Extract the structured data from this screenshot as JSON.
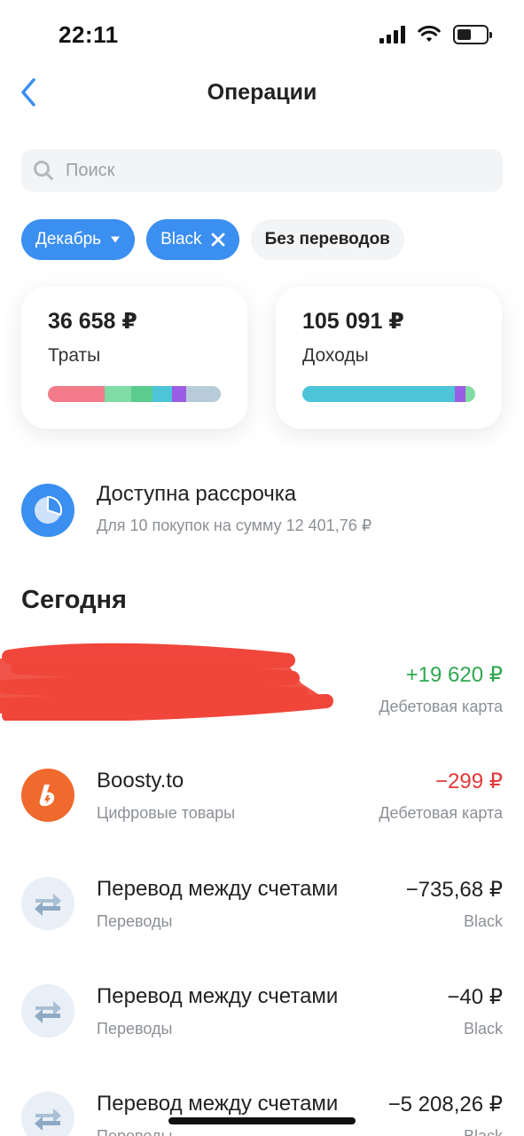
{
  "status": {
    "time": "22:11"
  },
  "header": {
    "title": "Операции"
  },
  "search": {
    "placeholder": "Поиск"
  },
  "filters": {
    "month": "Декабрь",
    "card": "Black",
    "transfers": "Без переводов"
  },
  "summary": {
    "expenses": {
      "amount": "36 658 ₽",
      "label": "Траты"
    },
    "income": {
      "amount": "105 091 ₽",
      "label": "Доходы"
    }
  },
  "colors": {
    "accent": "#3b8ff0",
    "income_green": "#2fa84f",
    "expense_red": "#e33838",
    "boosty_orange": "#ef6a2c"
  },
  "installment": {
    "title": "Доступна рассрочка",
    "subtitle": "Для 10 покупок на сумму 12 401,76 ₽"
  },
  "section": {
    "today": "Сегодня"
  },
  "operations": [
    {
      "title": "",
      "category": "",
      "amount": "+19 620 ₽",
      "account": "Дебетовая карта",
      "icon": "redacted"
    },
    {
      "title": "Boosty.to",
      "category": "Цифровые товары",
      "amount": "−299 ₽",
      "account": "Дебетовая карта",
      "icon": "boosty-icon"
    },
    {
      "title": "Перевод между счетами",
      "category": "Переводы",
      "amount": "−735,68 ₽",
      "account": "Black",
      "icon": "transfer-icon"
    },
    {
      "title": "Перевод между счетами",
      "category": "Переводы",
      "amount": "−40 ₽",
      "account": "Black",
      "icon": "transfer-icon"
    },
    {
      "title": "Перевод между счетами",
      "category": "Переводы",
      "amount": "−5 208,26 ₽",
      "account": "Black",
      "icon": "transfer-icon"
    }
  ]
}
